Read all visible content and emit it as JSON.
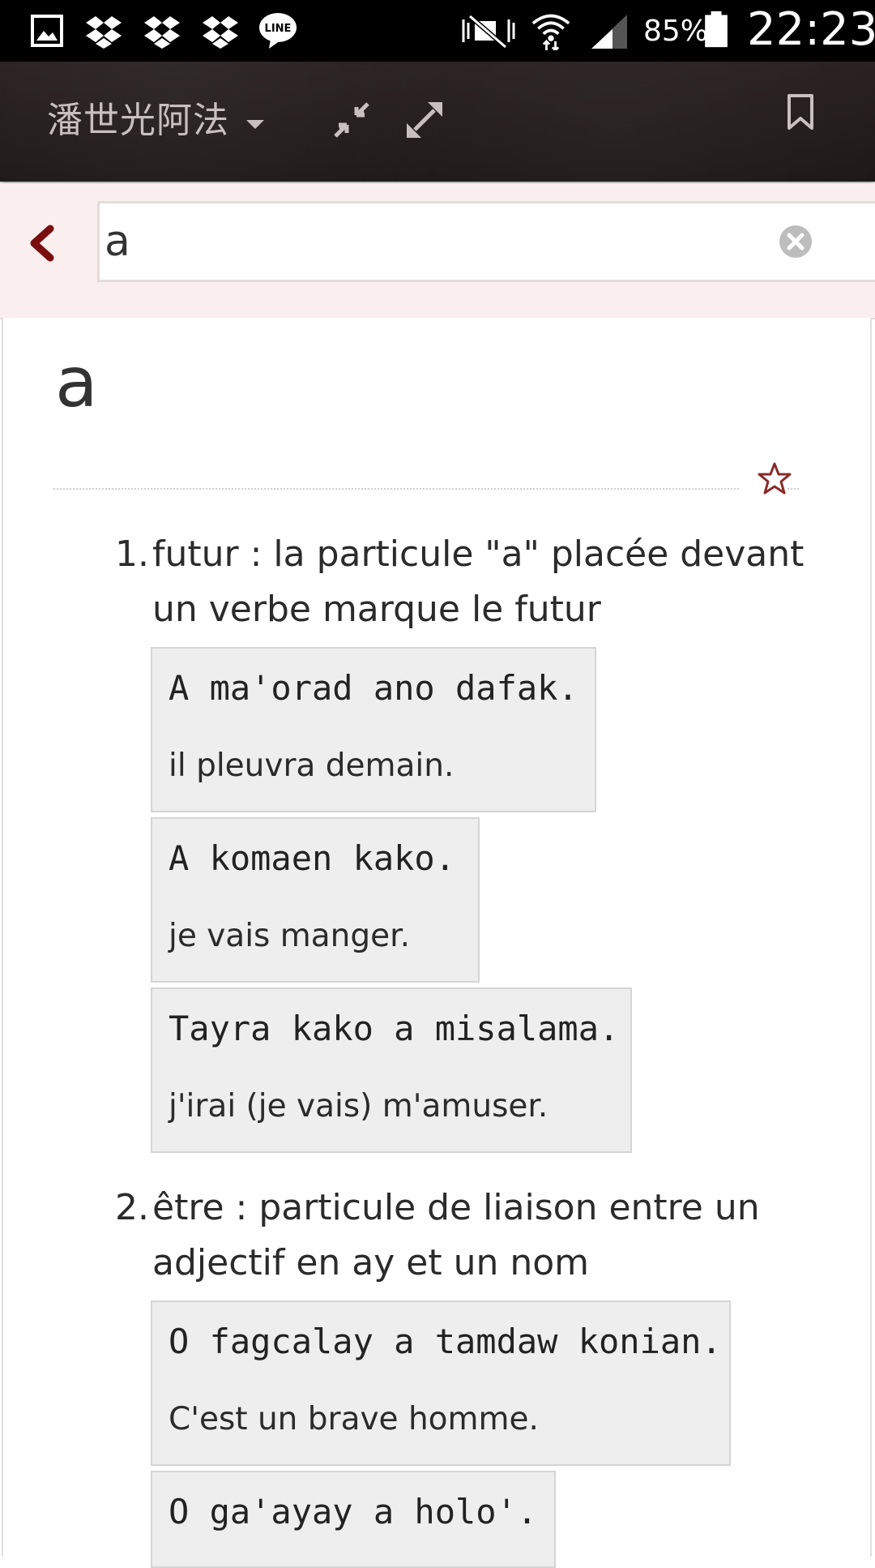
{
  "status_bar": {
    "battery": "85%",
    "time": "22:23",
    "notification_icons": [
      "gallery-icon",
      "dropbox-icon",
      "dropbox-icon",
      "dropbox-icon",
      "line-icon"
    ],
    "system_icons": [
      "mute-icon",
      "wifi-icon",
      "signal-icon",
      "battery-icon"
    ]
  },
  "app_bar": {
    "title": "潘世光阿法",
    "icons": [
      "caret-down-icon",
      "collapse-icon",
      "expand-icon",
      "bookmark-icon"
    ]
  },
  "search": {
    "query": "a"
  },
  "entry": {
    "headword": "a",
    "definitions": [
      {
        "num": "1.",
        "text": "futur : la particule \"a\" placée devant un verbe marque le futur",
        "examples": [
          {
            "src": "A ma'orad ano dafak.",
            "tr": "il pleuvra demain."
          },
          {
            "src": "A komaen kako.",
            "tr": "je vais manger."
          },
          {
            "src": "Tayra kako a misalama.",
            "tr": "j'irai (je vais) m'amuser."
          }
        ]
      },
      {
        "num": "2.",
        "text": "être : particule de liaison entre un adjectif en ay et un nom",
        "examples": [
          {
            "src": "O fagcalay a tamdaw konian.",
            "tr": "C'est un brave homme."
          },
          {
            "src": "O ga'ayay a holo'.",
            "tr": ""
          }
        ]
      }
    ]
  },
  "colors": {
    "app_bar": "#221b1b",
    "accent": "#7a0e0e",
    "search_row_bg": "#fbeeee",
    "example_bg": "#eeeeee"
  }
}
